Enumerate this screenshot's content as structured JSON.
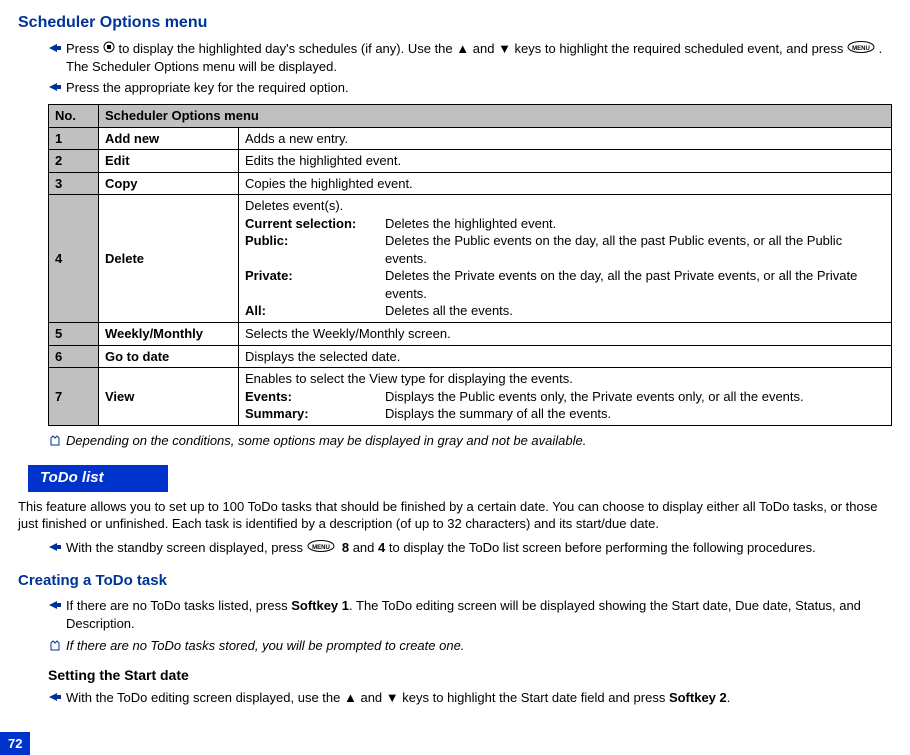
{
  "headings": {
    "scheduler_options": "Scheduler Options menu",
    "todo_bar": "ToDo list",
    "creating_task": "Creating a ToDo task",
    "setting_start": "Setting the Start date"
  },
  "scheduler": {
    "instr1_a": "Press ",
    "instr1_b": " to display the highlighted day's schedules (if any). Use the ",
    "instr1_c": " and ",
    "instr1_d": " keys to highlight the required scheduled event, and press ",
    "instr1_e": " . The Scheduler Options menu will be displayed.",
    "instr2": "Press the appropriate key for the required option.",
    "note_gray": "Depending on the conditions, some options may be displayed in gray and not be available."
  },
  "table": {
    "header_no": "No.",
    "header_menu": "Scheduler Options menu",
    "rows": [
      {
        "no": "1",
        "name": "Add new",
        "desc": "Adds a new entry."
      },
      {
        "no": "2",
        "name": "Edit",
        "desc": "Edits the highlighted event."
      },
      {
        "no": "3",
        "name": "Copy",
        "desc": "Copies the highlighted event."
      },
      {
        "no": "4",
        "name": "Delete",
        "desc_intro": "Deletes event(s).",
        "subs": [
          {
            "label": "Current selection:",
            "value": "Deletes the highlighted event."
          },
          {
            "label": "Public:",
            "value": "Deletes the Public events on the day, all the past Public events, or all the Public events."
          },
          {
            "label": "Private:",
            "value": "Deletes the Private events on the day, all the past Private events, or all the Private events."
          },
          {
            "label": "All:",
            "value": "Deletes all the events."
          }
        ]
      },
      {
        "no": "5",
        "name": "Weekly/Monthly",
        "desc": "Selects the Weekly/Monthly screen."
      },
      {
        "no": "6",
        "name": "Go to date",
        "desc": "Displays the selected date."
      },
      {
        "no": "7",
        "name": "View",
        "desc_intro": "Enables to select the View type for displaying the events.",
        "subs": [
          {
            "label": "Events:",
            "value": "Displays the Public events only, the Private events only, or all the events."
          },
          {
            "label": "Summary:",
            "value": "Displays the summary of all the events."
          }
        ]
      }
    ]
  },
  "todo": {
    "intro": "This feature allows you to set up to 100 ToDo tasks that should be finished by a certain date. You can choose to display either all ToDo tasks, or those just finished or unfinished. Each task is identified by a description (of up to 32 characters) and its start/due date.",
    "standby_a": "With the standby screen displayed, press ",
    "standby_b": "8",
    "standby_c": " and ",
    "standby_d": "4",
    "standby_e": " to display the ToDo list screen before performing the following procedures.",
    "create_instr_a": "If there are no ToDo tasks listed, press ",
    "create_instr_softkey": "Softkey 1",
    "create_instr_b": ". The ToDo editing screen will be displayed showing the Start date, Due date, Status, and Description.",
    "create_note": "If there are no ToDo tasks stored, you will be prompted to create one.",
    "set_start_a": "With the ToDo editing screen displayed, use the ",
    "set_start_b": " and ",
    "set_start_c": " keys to highlight the Start date field and press ",
    "set_start_softkey": "Softkey 2",
    "set_start_d": "."
  },
  "page_number": "72",
  "symbols": {
    "up": "▲",
    "down": "▼"
  }
}
